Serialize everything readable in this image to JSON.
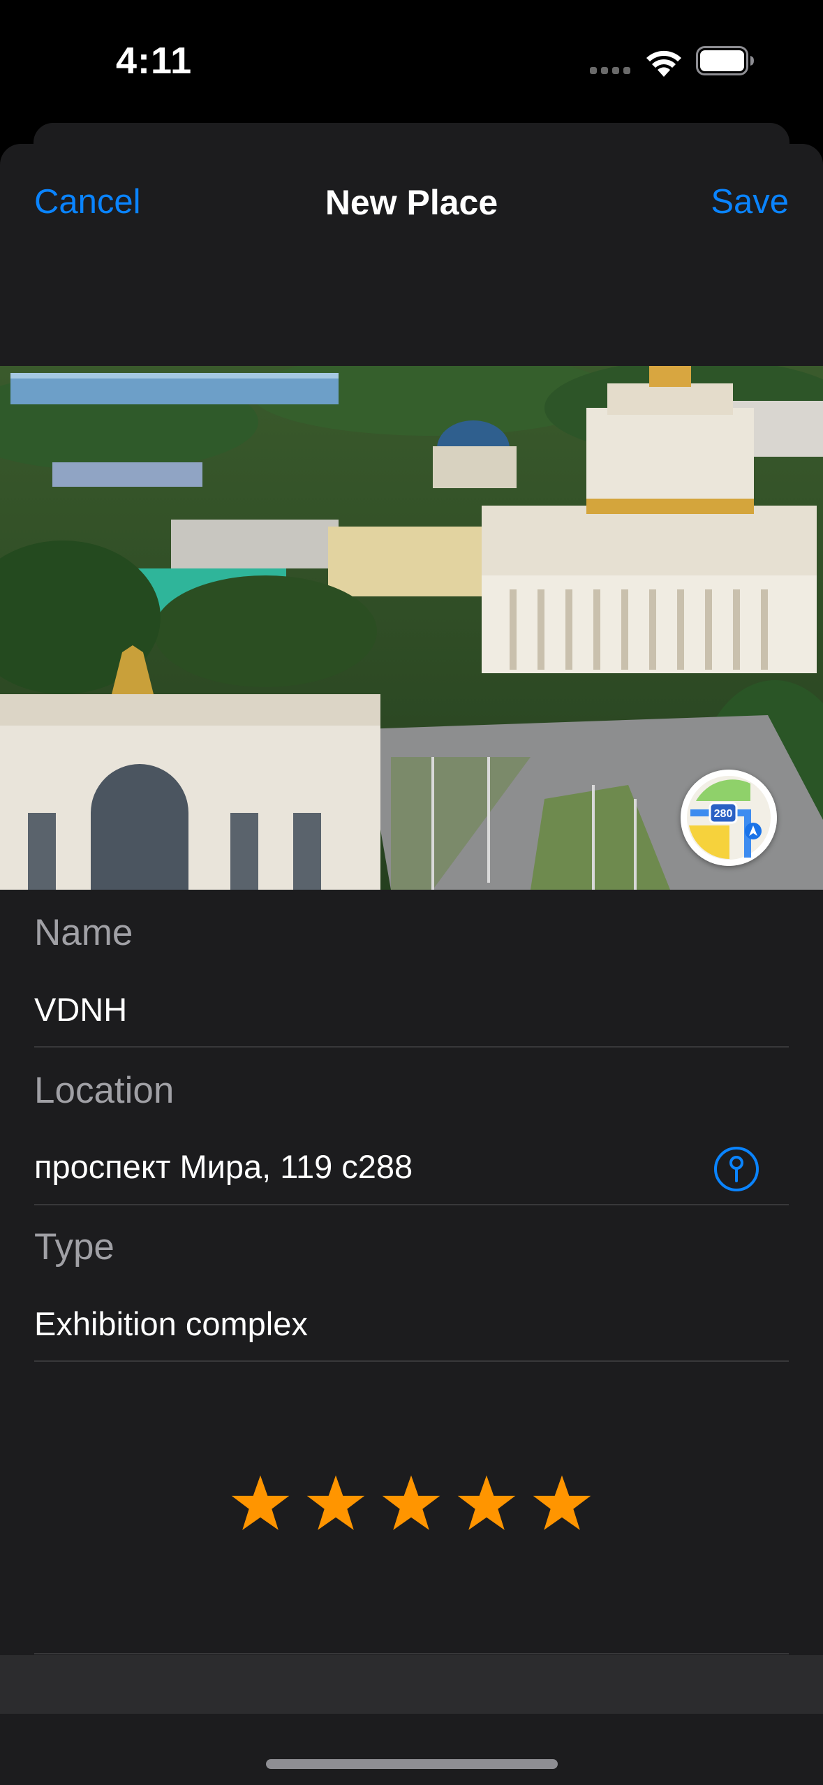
{
  "status_bar": {
    "time": "4:11",
    "icons": [
      "cellular-dots-icon",
      "wifi-icon",
      "battery-icon"
    ]
  },
  "nav": {
    "cancel_label": "Cancel",
    "title": "New Place",
    "save_label": "Save"
  },
  "photo": {
    "description_icon": "place-photo",
    "map_button_icon": "maps-app-icon",
    "map_icon_text": "280"
  },
  "form": {
    "name_label": "Name",
    "name_value": "VDNH",
    "location_label": "Location",
    "location_value": "проспект Мира, 119 с288",
    "location_button_icon": "map-pin-icon",
    "type_label": "Type",
    "type_value": "Exhibition complex"
  },
  "rating": {
    "value": 5,
    "max": 5
  },
  "colors": {
    "accent": "#0a84ff",
    "star": "#ff9500",
    "background": "#1c1c1e"
  }
}
